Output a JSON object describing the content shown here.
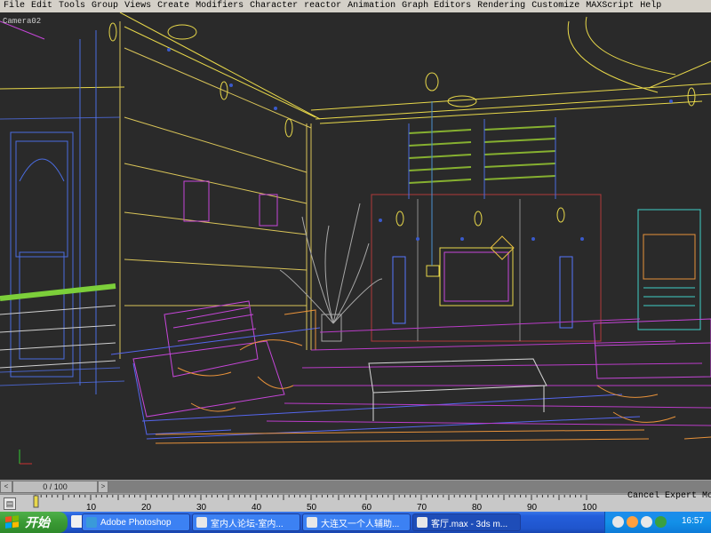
{
  "menu": [
    "File",
    "Edit",
    "Tools",
    "Group",
    "Views",
    "Create",
    "Modifiers",
    "Character",
    "reactor",
    "Animation",
    "Graph Editors",
    "Rendering",
    "Customize",
    "MAXScript",
    "Help"
  ],
  "viewport": {
    "label": "Camera02"
  },
  "timeslider": {
    "value": "0 / 100"
  },
  "trackbar": {
    "ticks": [
      "10",
      "20",
      "30",
      "40",
      "50",
      "60",
      "70",
      "80",
      "90",
      "100"
    ]
  },
  "status": {
    "text": "Cancel Expert Mode"
  },
  "taskbar": {
    "start_label": "开始",
    "tasks": [
      {
        "label": "Adobe Photoshop"
      },
      {
        "label": "室内人论坛-室内..."
      },
      {
        "label": "大连又一个人辅助..."
      },
      {
        "label": "客厅.max - 3ds m..."
      }
    ],
    "clock": "16:57"
  },
  "colors": {
    "viewport_bg": "#2a2a2a",
    "wire_yellow": "#e8d84a",
    "wire_magenta": "#c646d9",
    "wire_orange": "#e8923a",
    "wire_blue": "#4a6ce0"
  }
}
